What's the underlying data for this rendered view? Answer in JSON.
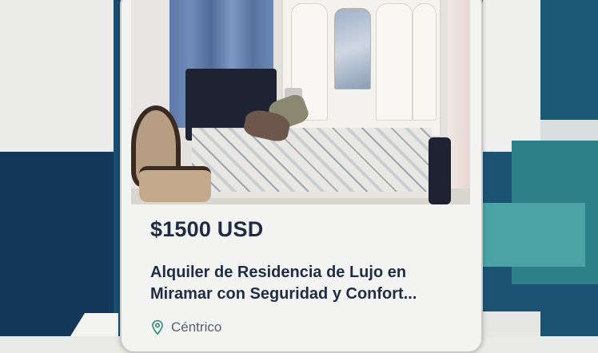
{
  "listing": {
    "price": "$1500 USD",
    "title": "Alquiler de Residencia de Lujo en Miramar con Seguridad y Confort...",
    "location": "Céntrico",
    "location_icon": "map-pin-icon"
  },
  "colors": {
    "price_text": "#1d2b43",
    "title_text": "#1f2d44",
    "location_icon": "#2f8a7a",
    "background_navy": "#14385a",
    "background_teal": "#4ba3a3"
  }
}
